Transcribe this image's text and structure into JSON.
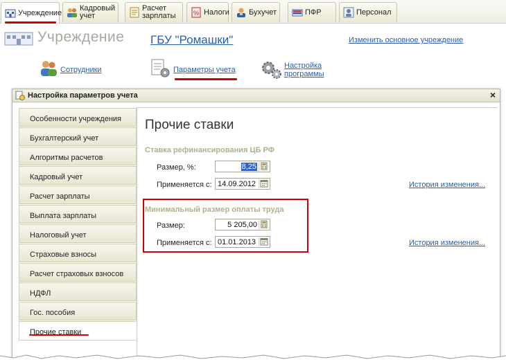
{
  "tabs": [
    {
      "label": "Учреждение",
      "icon": "institution-icon"
    },
    {
      "label": "Кадровый учет",
      "line1": "Кадровый",
      "line2": "учет",
      "icon": "personnel-icon"
    },
    {
      "label": "Расчет зарплаты",
      "line1": "Расчет",
      "line2": "зарплаты",
      "icon": "payroll-icon"
    },
    {
      "label": "Налоги",
      "icon": "taxes-icon"
    },
    {
      "label": "Бухучет",
      "icon": "accounting-icon"
    },
    {
      "label": "ПФР",
      "icon": "pension-fund-icon"
    },
    {
      "label": "Персонал",
      "icon": "staff-icon"
    }
  ],
  "header": {
    "title": "Учреждение",
    "organization": "ГБУ \"Ромашки\"",
    "change_link": "Изменить основное учреждение",
    "nav": {
      "employees": "Сотрудники",
      "accounting_params": "Параметры учета",
      "settings_line1": "Настройка",
      "settings_line2": "программы"
    }
  },
  "dialog": {
    "title": "Настройка параметров учета",
    "close": "×",
    "sidebar": [
      "Особенности учреждения",
      "Бухгалтерский учет",
      "Алгоритмы расчетов",
      "Кадровый учет",
      "Расчет зарплаты",
      "Выплата зарплаты",
      "Налоговый учет",
      "Страховые взносы",
      "Расчет страховых взносов",
      "НДФЛ",
      "Гос. пособия",
      "Прочие ставки"
    ],
    "active_item": "Прочие ставки",
    "content": {
      "title": "Прочие ставки",
      "refinancing": {
        "title": "Ставка рефинансирования ЦБ РФ",
        "size_label": "Размер, %:",
        "size_value": "8,25",
        "date_label": "Применяется с:",
        "date_value": "14.09.2012",
        "history_link": "История изменения..."
      },
      "min_wage": {
        "title": "Минимальный размер оплаты труда",
        "size_label": "Размер:",
        "size_value": "5 205,00",
        "date_label": "Применяется с:",
        "date_value": "01.01.2013",
        "history_link": "История изменения..."
      }
    }
  },
  "colors": {
    "accent_red": "#d40000",
    "link_blue": "#2a5db0",
    "section_title": "#b3af8c"
  }
}
